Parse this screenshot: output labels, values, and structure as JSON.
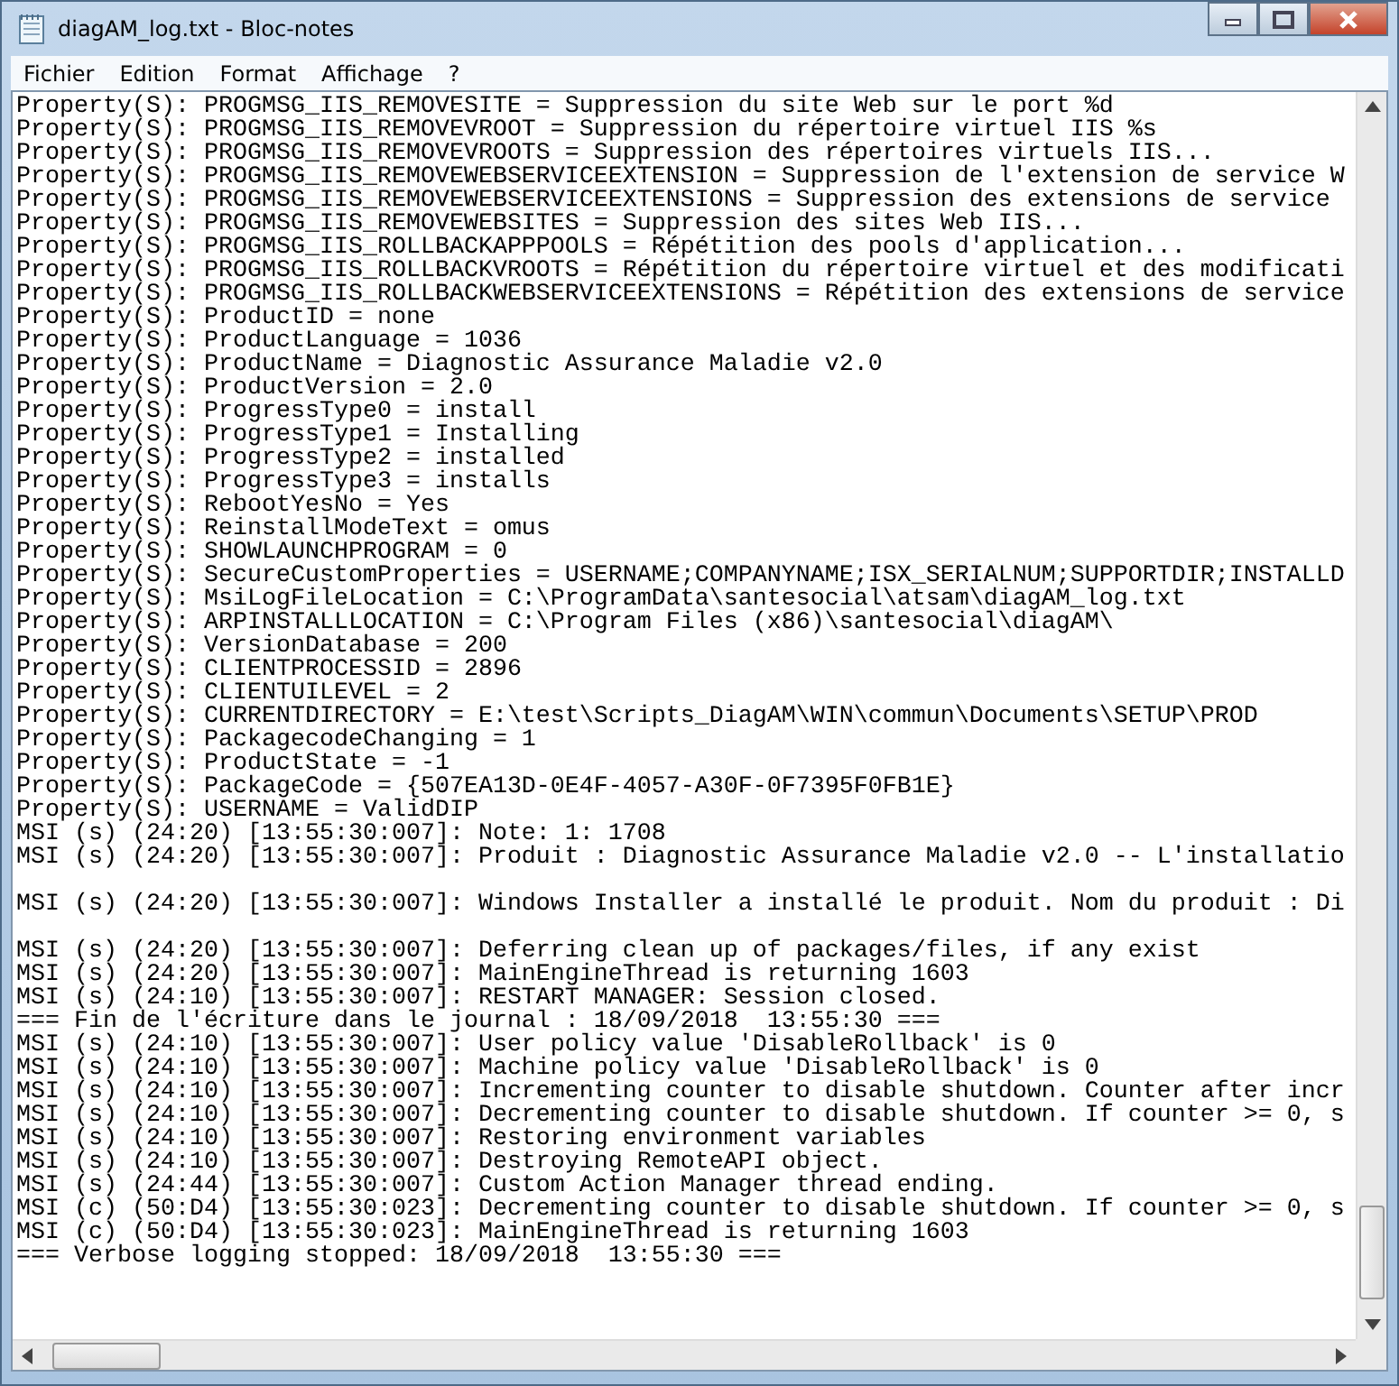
{
  "window": {
    "title": "diagAM_log.txt - Bloc-notes"
  },
  "menu": [
    "Fichier",
    "Edition",
    "Format",
    "Affichage",
    "?"
  ],
  "lines": [
    {
      "text": "Property(S): PROGMSG_IIS_REMOVESITE = Suppression du site Web sur le port %d"
    },
    {
      "text": "Property(S): PROGMSG_IIS_REMOVEVROOT = Suppression du répertoire virtuel IIS %s"
    },
    {
      "text": "Property(S): PROGMSG_IIS_REMOVEVROOTS = Suppression des répertoires virtuels IIS..."
    },
    {
      "text": "Property(S): PROGMSG_IIS_REMOVEWEBSERVICEEXTENSION = Suppression de l'extension de service W"
    },
    {
      "text": "Property(S): PROGMSG_IIS_REMOVEWEBSERVICEEXTENSIONS = Suppression des extensions de service"
    },
    {
      "text": "Property(S): PROGMSG_IIS_REMOVEWEBSITES = Suppression des sites Web IIS..."
    },
    {
      "text": "Property(S): PROGMSG_IIS_ROLLBACKAPPPOOLS = Répétition des pools d'application..."
    },
    {
      "text": "Property(S): PROGMSG_IIS_ROLLBACKVROOTS = Répétition du répertoire virtuel et des modificati"
    },
    {
      "text": "Property(S): PROGMSG_IIS_ROLLBACKWEBSERVICEEXTENSIONS = Répétition des extensions de service"
    },
    {
      "text": "Property(S): ProductID = none"
    },
    {
      "text": "Property(S): ProductLanguage = 1036"
    },
    {
      "text": "Property(S): ProductName = Diagnostic Assurance Maladie v2.0"
    },
    {
      "text": "Property(S): ProductVersion = 2.0"
    },
    {
      "text": "Property(S): ProgressType0 = install"
    },
    {
      "text": "Property(S): ProgressType1 = Installing"
    },
    {
      "text": "Property(S): ProgressType2 = installed"
    },
    {
      "text": "Property(S): ProgressType3 = installs"
    },
    {
      "text": "Property(S): RebootYesNo = Yes"
    },
    {
      "text": "Property(S): ReinstallModeText = omus"
    },
    {
      "text": "Property(S): SHOWLAUNCHPROGRAM = 0"
    },
    {
      "text": "Property(S): SecureCustomProperties = USERNAME;COMPANYNAME;ISX_SERIALNUM;SUPPORTDIR;INSTALLD"
    },
    {
      "text": "Property(S): MsiLogFileLocation = C:\\ProgramData\\santesocial\\atsam\\diagAM_log.txt"
    },
    {
      "text": "Property(S): ARPINSTALLLOCATION = C:\\Program Files (x86)\\santesocial\\diagAM\\"
    },
    {
      "text": "Property(S): VersionDatabase = 200"
    },
    {
      "text": "Property(S): CLIENTPROCESSID = 2896"
    },
    {
      "text": "Property(S): CLIENTUILEVEL = 2"
    },
    {
      "text": "Property(S): CURRENTDIRECTORY = E:\\test\\Scripts_DiagAM\\WIN\\commun\\Documents\\SETUP\\PROD"
    },
    {
      "text": "Property(S): PackagecodeChanging = 1"
    },
    {
      "text": "Property(S): ProductState = -1"
    },
    {
      "text": "Property(S): PackageCode = {507EA13D-0E4F-4057-A30F-0F7395F0FB1E}"
    },
    {
      "text": "Property(S): USERNAME = ValidDIP"
    },
    {
      "text": "MSI (s) (24:20) [13:55:30:007]: Note: 1: 1708"
    },
    {
      "text": "MSI (s) (24:20) [13:55:30:007]: Produit : Diagnostic Assurance Maladie v2.0 -- L'installatio"
    },
    {
      "kind": "blank"
    },
    {
      "text": "MSI (s) (24:20) [13:55:30:007]: Windows Installer a installé le produit. Nom du produit : Di"
    },
    {
      "kind": "blank"
    },
    {
      "text": "MSI (s) (24:20) [13:55:30:007]: Deferring clean up of packages/files, if any exist"
    },
    {
      "text": "MSI (s) (24:20) [13:55:30:007]: MainEngineThread is returning 1603"
    },
    {
      "text": "MSI (s) (24:10) [13:55:30:007]: RESTART MANAGER: Session closed."
    },
    {
      "text": "=== Fin de l'écriture dans le journal : 18/09/2018  13:55:30 ==="
    },
    {
      "text": "MSI (s) (24:10) [13:55:30:007]: User policy value 'DisableRollback' is 0"
    },
    {
      "text": "MSI (s) (24:10) [13:55:30:007]: Machine policy value 'DisableRollback' is 0"
    },
    {
      "text": "MSI (s) (24:10) [13:55:30:007]: Incrementing counter to disable shutdown. Counter after incr"
    },
    {
      "text": "MSI (s) (24:10) [13:55:30:007]: Decrementing counter to disable shutdown. If counter >= 0, s"
    },
    {
      "text": "MSI (s) (24:10) [13:55:30:007]: Restoring environment variables"
    },
    {
      "text": "MSI (s) (24:10) [13:55:30:007]: Destroying RemoteAPI object."
    },
    {
      "text": "MSI (s) (24:44) [13:55:30:007]: Custom Action Manager thread ending."
    },
    {
      "text": "MSI (c) (50:D4) [13:55:30:023]: Decrementing counter to disable shutdown. If counter >= 0, s"
    },
    {
      "text": "MSI (c) (50:D4) [13:55:30:023]: MainEngineThread is returning 1603"
    },
    {
      "text": "=== Verbose logging stopped: 18/09/2018  13:55:30 ==="
    }
  ]
}
